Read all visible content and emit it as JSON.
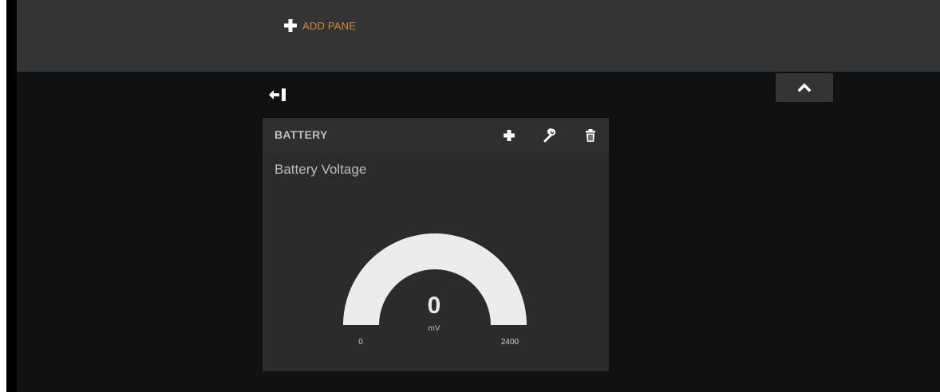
{
  "toolbar": {
    "add_pane_label": "ADD PANE",
    "add_icon": "plus-icon",
    "accent_color": "#d0893a"
  },
  "board": {
    "collapse_icon": "chevron-up-icon",
    "column_shrink_icon": "arrow-to-line-left-icon"
  },
  "pane": {
    "title": "BATTERY",
    "tools": [
      "plus-icon",
      "wrench-icon",
      "trash-icon"
    ],
    "widget": {
      "title": "Battery Voltage",
      "type": "gauge",
      "value": "0",
      "units": "mV",
      "min": "0",
      "max": "2400",
      "gauge_color": "#ececec"
    }
  }
}
